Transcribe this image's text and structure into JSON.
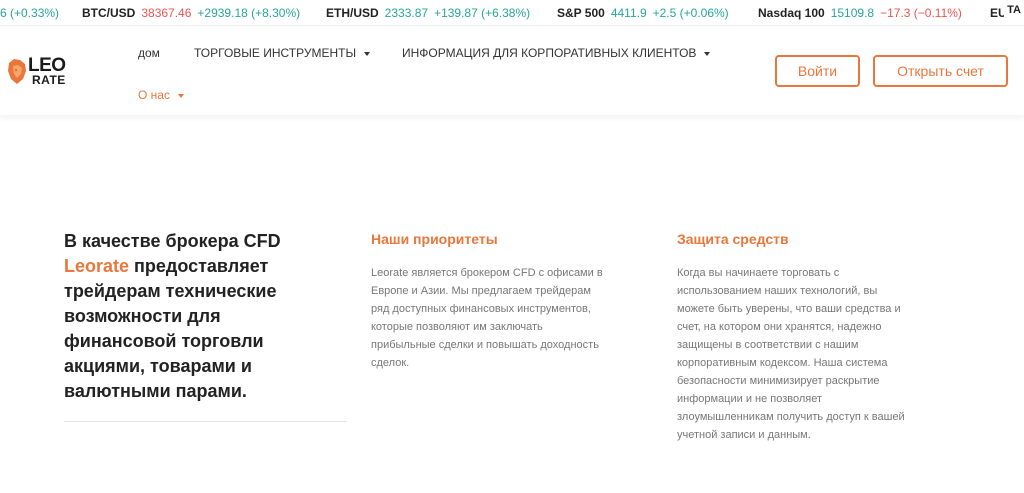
{
  "ticker": [
    {
      "sym": "",
      "price": "",
      "chg": "6 (+0.33%)",
      "dir": "up"
    },
    {
      "sym": "BTC/USD",
      "price": "38367.46",
      "chg": "+2939.18 (+8.30%)",
      "dir": "up",
      "price_dir": "down"
    },
    {
      "sym": "ETH/USD",
      "price": "2333.87",
      "chg": "+139.87 (+6.38%)",
      "dir": "up"
    },
    {
      "sym": "S&P 500",
      "price": "4411.9",
      "chg": "+2.5 (+0.06%)",
      "dir": "up"
    },
    {
      "sym": "Nasdaq 100",
      "price": "15109.8",
      "chg": "−17.3 (−0.11%)",
      "dir": "down",
      "price_dir": "up"
    },
    {
      "sym": "EU",
      "price": "",
      "chg": "",
      "dir": "up"
    }
  ],
  "ticker_badge": "TA",
  "logo": {
    "top": "LEO",
    "bottom": "RATE"
  },
  "nav": {
    "home": "дом",
    "instruments": "ТОРГОВЫЕ ИНСТРУМЕНТЫ",
    "corporate": "ИНФОРМАЦИЯ ДЛЯ КОРПОРАТИВНЫХ КЛИЕНТОВ",
    "about": "О нас"
  },
  "buttons": {
    "login": "Войти",
    "open_account": "Открыть счет"
  },
  "intro": {
    "before": "В качестве брокера CFD ",
    "brand": "Leorate",
    "after": " предоставляет трейдерам технические возможности для финансовой торговли акциями, товарами и валютными парами."
  },
  "priorities": {
    "title": "Наши приоритеты",
    "lines": [
      "Leorate является брокером CFD с офисами в",
      "Европе и Азии. Мы предлагаем трейдерам",
      "ряд доступных финансовых инструментов,",
      "которые позволяют им заключать",
      "прибыльные сделки и повышать доходность",
      "сделок."
    ]
  },
  "protection": {
    "title": "Защита средств",
    "lines": [
      "Когда вы начинаете торговать с",
      "использованием наших технологий, вы",
      "можете быть уверены, что ваши средства и",
      "счет, на котором они хранятся, надежно",
      "защищены в соответствии с нашим",
      "корпоративным кодексом. Наша система",
      "безопасности минимизирует раскрытие",
      "информации и не позволяет",
      "злоумышленникам получить доступ к вашей",
      "учетной записи и данным."
    ]
  },
  "colors": {
    "accent": "#e9773b",
    "up": "#26a69a",
    "down": "#ef5350"
  }
}
